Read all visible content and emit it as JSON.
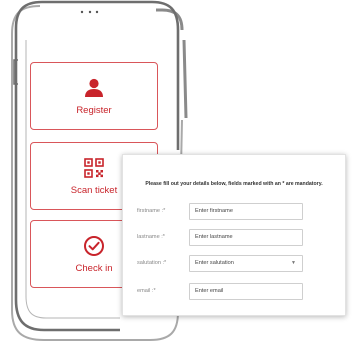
{
  "menu": {
    "items": [
      {
        "label": "Register",
        "icon": "person-icon"
      },
      {
        "label": "Scan ticket",
        "icon": "qr-code-icon"
      },
      {
        "label": "Check in",
        "icon": "check-circle-icon"
      }
    ]
  },
  "form": {
    "instructions": "Please fill out your details below, fields marked with an * are mandatory.",
    "fields": [
      {
        "label": "firstname :*",
        "placeholder": "Enter firstname"
      },
      {
        "label": "lastname :*",
        "placeholder": "Enter lastname"
      },
      {
        "label": "salutation :*",
        "placeholder": "Enter salutation"
      },
      {
        "label": "email :*",
        "placeholder": "Enter email"
      }
    ]
  },
  "colors": {
    "accent": "#c8242b",
    "card_border": "#d9565a",
    "phone_outline": "#7a7a7a"
  }
}
